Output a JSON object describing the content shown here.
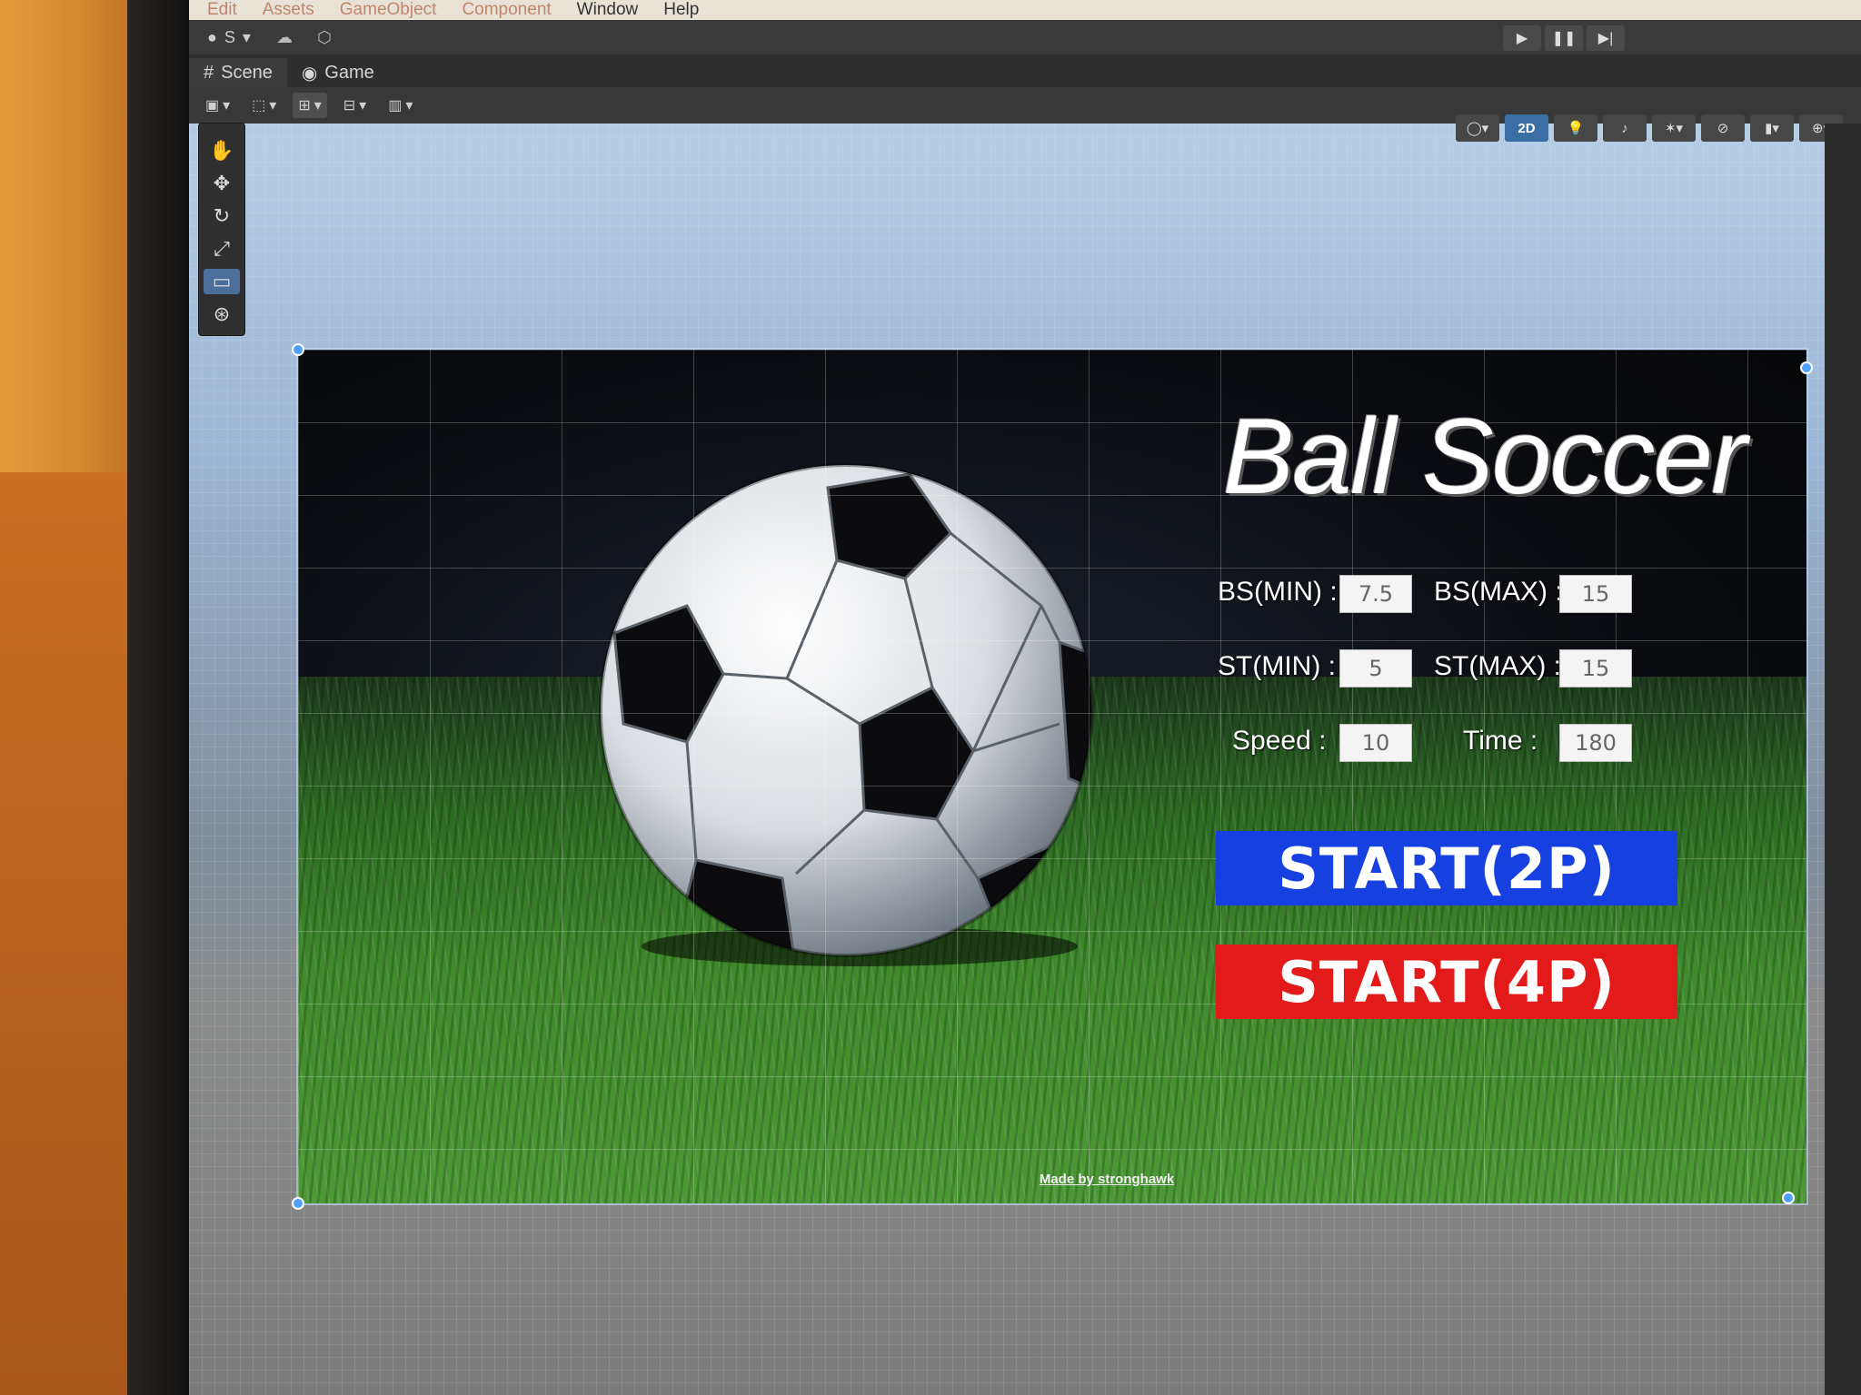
{
  "menu": {
    "items": [
      "Edit",
      "Assets",
      "GameObject",
      "Component",
      "Window",
      "Help"
    ]
  },
  "toolbar": {
    "account_label": "S"
  },
  "tabs": [
    {
      "label": "Scene"
    },
    {
      "label": "Game"
    }
  ],
  "scene_toolbar": {
    "mode_2d_label": "2D"
  },
  "game": {
    "title": "Ball Soccer",
    "params": {
      "bs_min_label": "BS(MIN) :",
      "bs_min_value": "7.5",
      "bs_max_label": "BS(MAX) :",
      "bs_max_value": "15",
      "st_min_label": "ST(MIN) :",
      "st_min_value": "5",
      "st_max_label": "ST(MAX) :",
      "st_max_value": "15",
      "speed_label": "Speed :",
      "speed_value": "10",
      "time_label": "Time :",
      "time_value": "180"
    },
    "buttons": {
      "start_2p": "START(2P)",
      "start_4p": "START(4P)"
    },
    "credit": "Made by stronghawk"
  },
  "colors": {
    "start_2p_bg": "#1640e0",
    "start_4p_bg": "#e21a1a",
    "editor_dark": "#3a3a3a"
  }
}
